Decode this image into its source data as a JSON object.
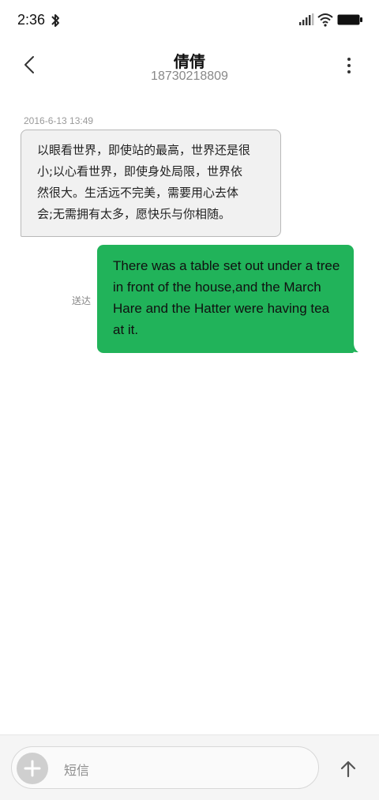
{
  "status_bar": {
    "time": "2:36",
    "icons": [
      "bluetooth-icon",
      "signal-icon",
      "wifi-icon",
      "battery-icon"
    ]
  },
  "header": {
    "contact_name": "倩倩",
    "contact_number": "18730218809",
    "back_icon": "chevron-left-icon",
    "more_icon": "more-vertical-icon"
  },
  "conversation": {
    "timestamp": "2016-6-13 13:49",
    "incoming": {
      "lines": [
        "以眼看世界，即使站的最高，世界还是很",
        "小;以心看世界，即使身处局限，世界依",
        "然很大。生活远不完美，需要用心去体",
        "会;无需拥有太多，愿快乐与你相随。"
      ]
    },
    "outgoing": {
      "lines": [
        "There was a table set out under a tree",
        "in front of the house,and the March",
        "Hare and the Hatter were having tea",
        "at it."
      ],
      "status": "送达"
    }
  },
  "composer": {
    "placeholder": "短信",
    "add_icon": "plus-icon",
    "send_icon": "arrow-up-icon"
  },
  "colors": {
    "outgoing_bubble": "#21b35a",
    "incoming_bubble": "#f1f1f1",
    "incoming_border": "#b8b8b8"
  }
}
